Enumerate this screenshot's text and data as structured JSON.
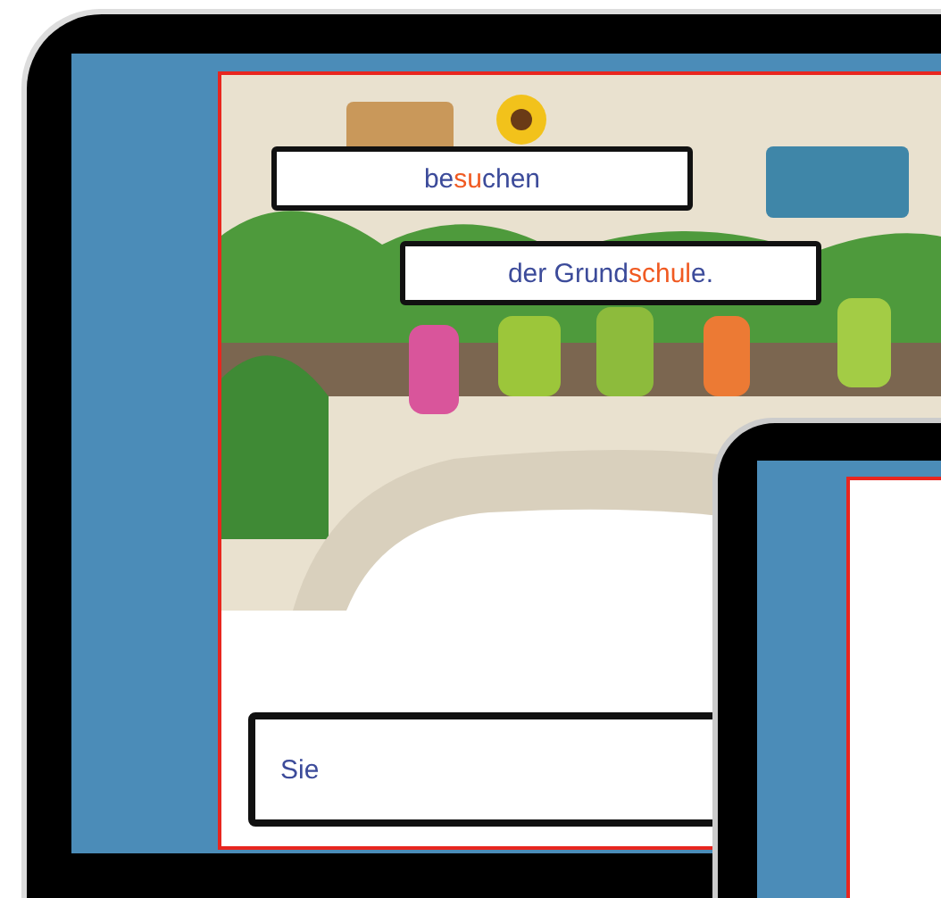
{
  "word_chips": [
    {
      "segments": [
        {
          "text": "be",
          "highlight": false
        },
        {
          "text": "su",
          "highlight": true
        },
        {
          "text": "chen",
          "highlight": false
        }
      ]
    },
    {
      "segments": [
        {
          "text": "der Grund",
          "highlight": false
        },
        {
          "text": "schul",
          "highlight": true
        },
        {
          "text": "e.",
          "highlight": false
        }
      ]
    }
  ],
  "answer_box": {
    "text": "Sie"
  }
}
